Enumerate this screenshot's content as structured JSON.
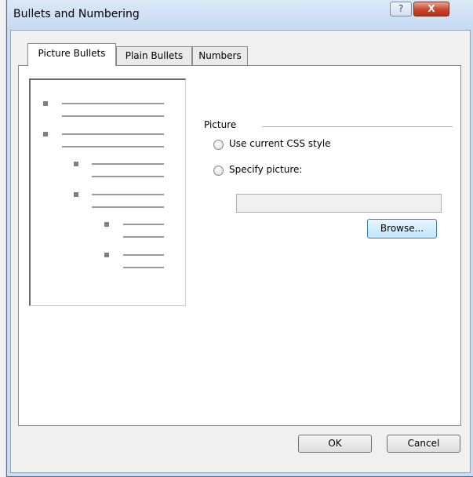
{
  "window": {
    "title": "Bullets and Numbering",
    "help_label": "?",
    "close_label": "X"
  },
  "tabs": [
    {
      "label": "Picture Bullets",
      "active": true
    },
    {
      "label": "Plain Bullets",
      "active": false
    },
    {
      "label": "Numbers",
      "active": false
    }
  ],
  "picture_group": {
    "label": "Picture",
    "options": [
      {
        "label": "Use current CSS style",
        "selected": false
      },
      {
        "label": "Specify picture:",
        "selected": false
      }
    ],
    "picture_path": "",
    "browse_label": "Browse..."
  },
  "footer": {
    "ok_label": "OK",
    "cancel_label": "Cancel"
  }
}
